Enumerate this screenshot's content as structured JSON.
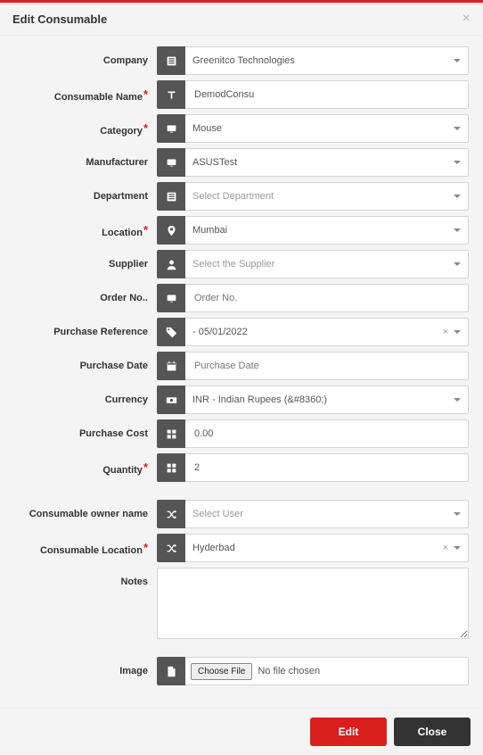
{
  "header": {
    "title": "Edit Consumable"
  },
  "labels": {
    "company": "Company",
    "consumable_name": "Consumable Name",
    "category": "Category",
    "manufacturer": "Manufacturer",
    "department": "Department",
    "location": "Location",
    "supplier": "Supplier",
    "order_no": "Order No..",
    "purchase_reference": "Purchase Reference",
    "purchase_date": "Purchase Date",
    "currency": "Currency",
    "purchase_cost": "Purchase Cost",
    "quantity": "Quantity",
    "owner_name": "Consumable owner name",
    "consumable_location": "Consumable Location",
    "notes": "Notes",
    "image": "Image"
  },
  "values": {
    "company": "Greenitco Technologies",
    "consumable_name": "DemodConsu",
    "category": "Mouse",
    "manufacturer": "ASUSTest",
    "department": "Select Department",
    "location": "Mumbai",
    "supplier": "Select the Supplier",
    "order_no": "",
    "order_no_placeholder": "Order No.",
    "purchase_reference": "- 05/01/2022",
    "purchase_date": "",
    "purchase_date_placeholder": "Purchase Date",
    "currency": "INR - Indian Rupees (&#8360;)",
    "purchase_cost": "0.00",
    "quantity": "2",
    "owner_name": "Select User",
    "consumable_location": "Hyderbad",
    "notes": ""
  },
  "file": {
    "button": "Choose File",
    "text": "No file chosen"
  },
  "footer": {
    "edit": "Edit",
    "close": "Close"
  }
}
